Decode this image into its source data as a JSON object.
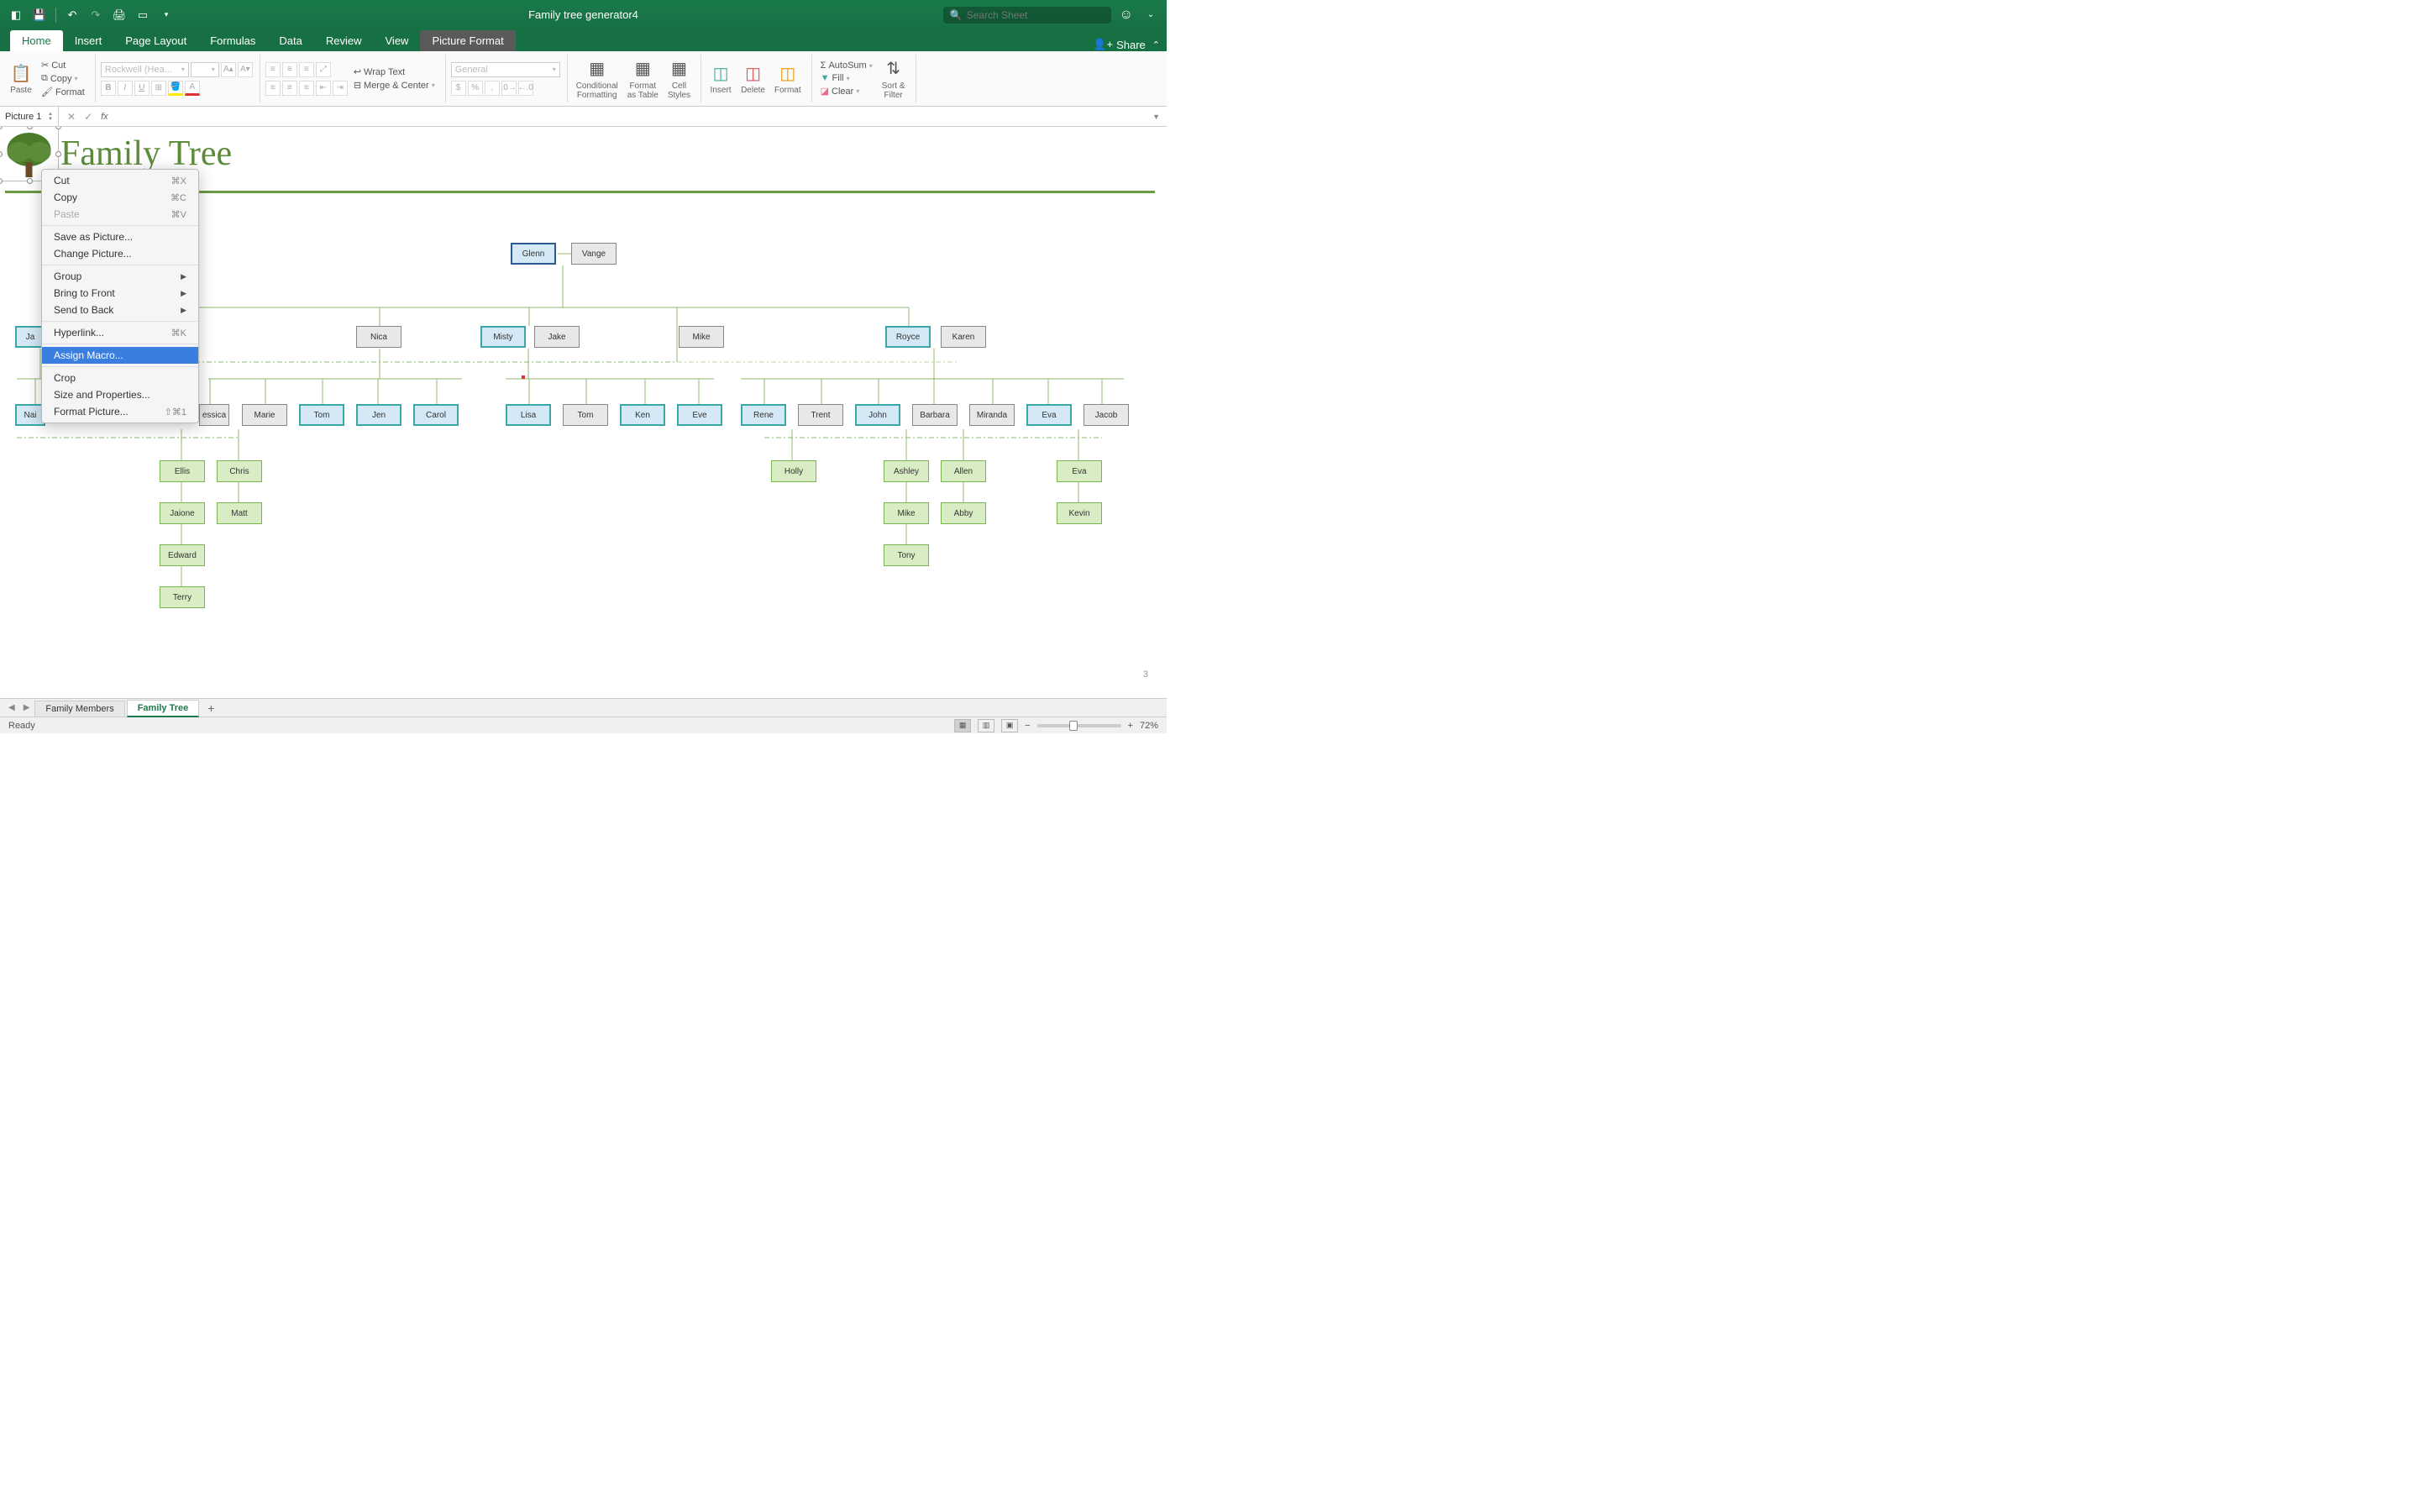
{
  "title": "Family tree generator4",
  "search_placeholder": "Search Sheet",
  "tabs": {
    "home": "Home",
    "insert": "Insert",
    "page_layout": "Page Layout",
    "formulas": "Formulas",
    "data": "Data",
    "review": "Review",
    "view": "View",
    "picture_format": "Picture Format",
    "share": "Share"
  },
  "ribbon": {
    "paste": "Paste",
    "cut": "Cut",
    "copy": "Copy",
    "format": "Format",
    "font_name": "Rockwell (Hea...",
    "wrap": "Wrap Text",
    "merge": "Merge & Center",
    "num_format": "General",
    "cond_fmt": "Conditional\nFormatting",
    "fmt_table": "Format\nas Table",
    "cell_styles": "Cell\nStyles",
    "insert": "Insert",
    "delete": "Delete",
    "format_btn": "Format",
    "autosum": "AutoSum",
    "fill": "Fill",
    "clear": "Clear",
    "sort": "Sort &\nFilter"
  },
  "namebox": "Picture 1",
  "doc_title": "Family Tree",
  "ctx": {
    "cut": "Cut",
    "cut_k": "⌘X",
    "copy": "Copy",
    "copy_k": "⌘C",
    "paste": "Paste",
    "paste_k": "⌘V",
    "save_pic": "Save as Picture...",
    "change_pic": "Change Picture...",
    "group": "Group",
    "btf": "Bring to Front",
    "stb": "Send to Back",
    "hyperlink": "Hyperlink...",
    "hyperlink_k": "⌘K",
    "assign_macro": "Assign Macro...",
    "crop": "Crop",
    "size_props": "Size and Properties...",
    "format_pic": "Format Picture...",
    "format_pic_k": "⇧⌘1"
  },
  "tree": {
    "gen1": [
      {
        "a": "Glenn",
        "b": "Vange"
      }
    ],
    "gen2": [
      {
        "a": "Ja",
        "b": ""
      },
      {
        "a": "",
        "b": "Nica"
      },
      {
        "a": "Misty",
        "b": "Jake"
      },
      {
        "a": "Mike",
        "b": ""
      },
      {
        "a": "Royce",
        "b": "Karen"
      }
    ],
    "gen3_row": [
      "Nai",
      "",
      "",
      "essica",
      "Marie",
      "Tom",
      "Jen",
      "Carol",
      "Lisa",
      "Tom",
      "Ken",
      "Eve",
      "Rene",
      "Trent",
      "John",
      "Barbara",
      "Miranda",
      "Eva",
      "Jacob"
    ],
    "gc_cols": {
      "c1": [
        "Ellis",
        "Jaione",
        "Edward",
        "Terry"
      ],
      "c2": [
        "Chris",
        "Matt"
      ],
      "c3": [
        "Holly"
      ],
      "c4": [
        "Ashley",
        "Mike",
        "Tony"
      ],
      "c5": [
        "Allen",
        "Abby"
      ],
      "c6": [
        "Eva",
        "Kevin"
      ]
    }
  },
  "sheets": {
    "members": "Family Members",
    "tree": "Family Tree"
  },
  "status": "Ready",
  "zoom": "72%",
  "page_num": "3"
}
